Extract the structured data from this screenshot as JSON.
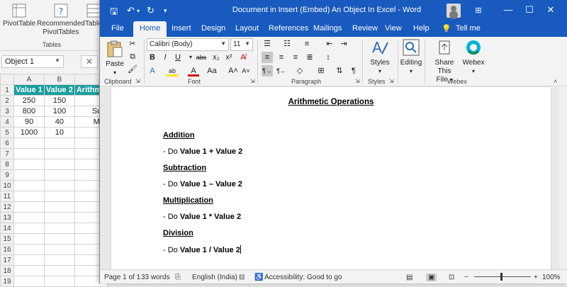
{
  "excel": {
    "ribbon": {
      "pivottable": "PivotTable",
      "recommended_line1": "Recommended",
      "recommended_line2": "PivotTables",
      "table": "Table",
      "group_label": "Tables"
    },
    "name_box": "Object 1",
    "columns": [
      "A",
      "B"
    ],
    "headers": [
      "Value 1",
      "Value 2",
      "Arithme"
    ],
    "rows": [
      [
        "250",
        "150",
        "A"
      ],
      [
        "800",
        "100",
        "Sub"
      ],
      [
        "90",
        "40",
        "Mul"
      ],
      [
        "1000",
        "10",
        "D"
      ]
    ],
    "row_numbers": [
      "1",
      "2",
      "3",
      "4",
      "5",
      "6",
      "7",
      "8",
      "9",
      "10",
      "11",
      "12",
      "13",
      "14",
      "15",
      "16",
      "17",
      "18",
      "19"
    ],
    "header_color": "#1a9e9e"
  },
  "word": {
    "title": "Document in Insert (Embed) An Object In Excel  -  Word",
    "accent": "#185abd",
    "tabs": [
      "File",
      "Home",
      "Insert",
      "Design",
      "Layout",
      "References",
      "Mailings",
      "Review",
      "View",
      "Help",
      "Tell me"
    ],
    "ribbon": {
      "paste": "Paste",
      "clipboard": "Clipboard",
      "font_name": "Calibri (Body)",
      "font_size": "11",
      "font_group": "Font",
      "paragraph_group": "Paragraph",
      "styles": "Styles",
      "styles_group": "Styles",
      "editing": "Editing",
      "share_line1": "Share This",
      "share_line2": "File",
      "webex": "Webex",
      "webex_group": "Webex"
    },
    "document": {
      "title": "Arithmetic Operations",
      "addition": "Addition",
      "addition_pre": "- Do ",
      "addition_bold": "Value 1 + Value 2",
      "subtraction": "Subtraction",
      "subtraction_pre": "- Do ",
      "subtraction_bold": "Value 1 – Value 2",
      "multiplication": "Multiplication",
      "multiplication_pre": "- Do ",
      "multiplication_bold": "Value 1 * Value 2",
      "division": "Division",
      "division_pre": "- Do ",
      "division_bold": "Value 1 / Value 2"
    },
    "status": {
      "page": "Page 1 of 1",
      "words": "33 words",
      "language": "English (India)",
      "accessibility": "Accessibility: Good to go",
      "zoom": "100%"
    }
  }
}
